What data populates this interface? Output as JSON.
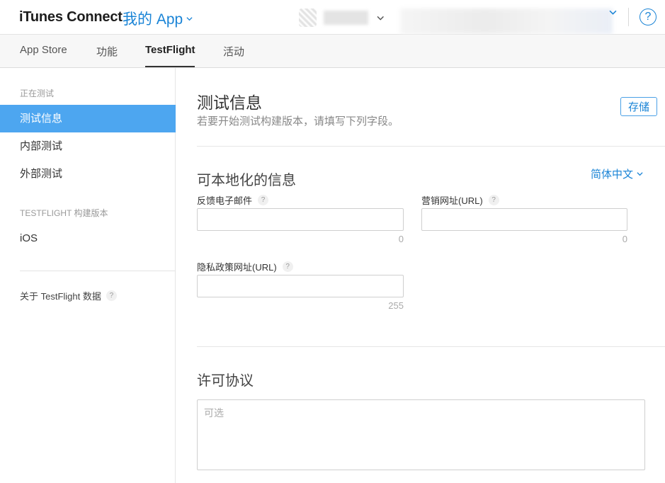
{
  "header": {
    "brand": "iTunes Connect",
    "my_app": "我的 App",
    "help": "?"
  },
  "tabs": [
    {
      "label": "App Store"
    },
    {
      "label": "功能"
    },
    {
      "label": "TestFlight"
    },
    {
      "label": "活动"
    }
  ],
  "sidebar": {
    "section_testing": "正在测试",
    "items": [
      {
        "label": "测试信息"
      },
      {
        "label": "内部测试"
      },
      {
        "label": "外部测试"
      }
    ],
    "section_builds": "TESTFLIGHT 构建版本",
    "builds_item": "iOS",
    "footer_label": "关于 TestFlight 数据",
    "footer_help": "?"
  },
  "main": {
    "title": "测试信息",
    "subtitle": "若要开始测试构建版本，请填写下列字段。",
    "save_label": "存储",
    "localizable": {
      "title": "可本地化的信息",
      "language": "简体中文",
      "feedback_email": {
        "label": "反馈电子邮件",
        "help": "?",
        "value": "",
        "counter": "0"
      },
      "marketing_url": {
        "label": "营销网址(URL)",
        "help": "?",
        "value": "",
        "counter": "0"
      },
      "privacy_url": {
        "label": "隐私政策网址(URL)",
        "help": "?",
        "value": "",
        "counter": "255"
      }
    },
    "license": {
      "title": "许可协议",
      "placeholder": "可选"
    }
  },
  "colors": {
    "accent": "#1a84d6",
    "sidebar_active": "#4da6f0"
  }
}
